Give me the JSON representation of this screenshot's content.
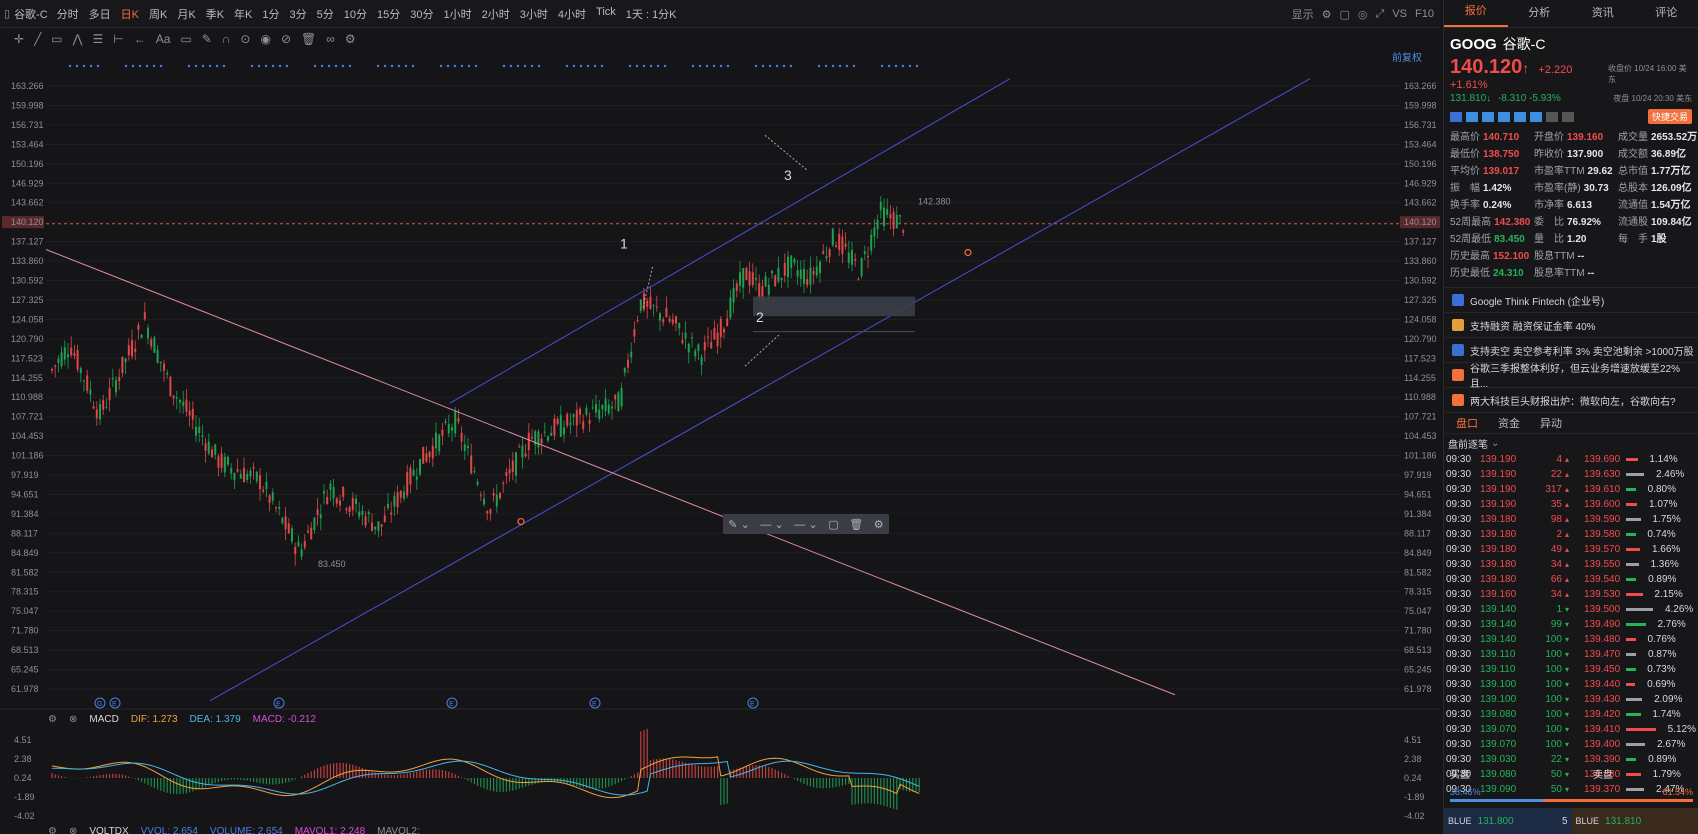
{
  "topbar": {
    "symbol": "谷歌-C",
    "timeframes": [
      "分时",
      "多日",
      "日K",
      "周K",
      "月K",
      "季K",
      "年K",
      "1分",
      "3分",
      "5分",
      "10分",
      "15分",
      "30分",
      "1小时",
      "2小时",
      "3小时",
      "4小时",
      "Tick",
      "1天 : 1分K"
    ],
    "active_timeframe": "日K",
    "right_items": [
      "显示",
      "VS",
      "F10"
    ]
  },
  "chart": {
    "price_ticks": [
      "163.266",
      "159.998",
      "156.731",
      "153.464",
      "150.196",
      "146.929",
      "143.662",
      "140.120",
      "137.127",
      "133.860",
      "130.592",
      "127.325",
      "124.058",
      "120.790",
      "117.523",
      "114.255",
      "110.988",
      "107.721",
      "104.453",
      "101.186",
      "97.919",
      "94.651",
      "91.384",
      "88.117",
      "84.849",
      "81.582",
      "78.315",
      "75.047",
      "71.780",
      "68.513",
      "65.245",
      "61.978"
    ],
    "current_price_label": "140.120",
    "high_label": "142.380",
    "low_label": "83.450",
    "wave_labels": [
      "1",
      "2",
      "3"
    ],
    "adjust_label": "前复权",
    "event_markers": [
      "E",
      "E",
      "E",
      "E",
      "E"
    ]
  },
  "macd": {
    "name": "MACD",
    "dif": "DIF: 1.273",
    "dea": "DEA: 1.379",
    "macd": "MACD: -0.212",
    "ticks": [
      "4.51",
      "2.38",
      "0.24",
      "-1.89",
      "-4.02"
    ]
  },
  "vol": {
    "name": "VOLTDX",
    "vvol": "VVOL: 2.654",
    "volume": "VOLUME: 2.654",
    "mavol1": "MAVOL1: 2.248",
    "mavol2": "MAVOL2:"
  },
  "panel": {
    "tabs": [
      "报价",
      "分析",
      "资讯",
      "评论"
    ],
    "active_tab": "报价",
    "symbol": "GOOG",
    "name": "谷歌-C",
    "price": "140.120",
    "change": "+2.220 +1.61%",
    "close_time": "收盘价 10/24 16:00 美东",
    "after_price": "131.810",
    "after_change": "-8.310 -5.93%",
    "after_time": "夜盘 10/24 20:30 美东",
    "quick_trade": "快捷交易",
    "stats": [
      [
        "最高价",
        "140.710",
        "red"
      ],
      [
        "开盘价",
        "139.160",
        "red"
      ],
      [
        "成交量",
        "2653.52万",
        "white"
      ],
      [
        "最低价",
        "138.750",
        "red"
      ],
      [
        "昨收价",
        "137.900",
        "white"
      ],
      [
        "成交额",
        "36.89亿",
        "white"
      ],
      [
        "平均价",
        "139.017",
        "red"
      ],
      [
        "市盈率TTM",
        "29.62",
        "white"
      ],
      [
        "总市值",
        "1.77万亿",
        "white"
      ],
      [
        "振　幅",
        "1.42%",
        "white"
      ],
      [
        "市盈率(静)",
        "30.73",
        "white"
      ],
      [
        "总股本",
        "126.09亿",
        "white"
      ],
      [
        "换手率",
        "0.24%",
        "white"
      ],
      [
        "市净率",
        "6.613",
        "white"
      ],
      [
        "流通值",
        "1.54万亿",
        "white"
      ],
      [
        "52周最高",
        "142.380",
        "red"
      ],
      [
        "委　比",
        "76.92%",
        "white"
      ],
      [
        "流通股",
        "109.84亿",
        "white"
      ],
      [
        "52周最低",
        "83.450",
        "green"
      ],
      [
        "量　比",
        "1.20",
        "white"
      ],
      [
        "每　手",
        "1股",
        "white"
      ],
      [
        "历史最高",
        "152.100",
        "red"
      ],
      [
        "股息TTM",
        "--",
        "white"
      ],
      [
        "",
        "",
        "white"
      ],
      [
        "历史最低",
        "24.310",
        "green"
      ],
      [
        "股息率TTM",
        "--",
        "white"
      ],
      [
        "",
        "",
        "white"
      ]
    ],
    "news": [
      "Google Think Fintech (企业号)",
      "支持融资 融资保证金率 40%",
      "支持卖空 卖空参考利率 3% 卖空池剩余 >1000万股",
      "谷歌三季报整体利好，但云业务增速放缓至22%且...",
      "两大科技巨头财报出炉：微软向左，谷歌向右?"
    ],
    "subtabs": [
      "盘口",
      "资金",
      "异动"
    ],
    "trades_title": "盘前逐笔",
    "trades": [
      [
        "09:30",
        "139.190",
        "4",
        "red",
        "139.690",
        "1.14%"
      ],
      [
        "09:30",
        "139.190",
        "22",
        "red",
        "139.630",
        "2.46%"
      ],
      [
        "09:30",
        "139.190",
        "317",
        "red",
        "139.610",
        "0.80%"
      ],
      [
        "09:30",
        "139.190",
        "35",
        "red",
        "139.600",
        "1.07%"
      ],
      [
        "09:30",
        "139.180",
        "98",
        "red",
        "139.590",
        "1.75%"
      ],
      [
        "09:30",
        "139.180",
        "2",
        "red",
        "139.580",
        "0.74%"
      ],
      [
        "09:30",
        "139.180",
        "49",
        "red",
        "139.570",
        "1.66%"
      ],
      [
        "09:30",
        "139.180",
        "34",
        "red",
        "139.550",
        "1.36%"
      ],
      [
        "09:30",
        "139.180",
        "66",
        "red",
        "139.540",
        "0.89%"
      ],
      [
        "09:30",
        "139.160",
        "34",
        "red",
        "139.530",
        "2.15%"
      ],
      [
        "09:30",
        "139.140",
        "1",
        "green",
        "139.500",
        "4.26%"
      ],
      [
        "09:30",
        "139.140",
        "99",
        "green",
        "139.490",
        "2.76%"
      ],
      [
        "09:30",
        "139.140",
        "100",
        "green",
        "139.480",
        "0.76%"
      ],
      [
        "09:30",
        "139.110",
        "100",
        "green",
        "139.470",
        "0.87%"
      ],
      [
        "09:30",
        "139.110",
        "100",
        "green",
        "139.450",
        "0.73%"
      ],
      [
        "09:30",
        "139.100",
        "100",
        "green",
        "139.440",
        "0.69%"
      ],
      [
        "09:30",
        "139.100",
        "100",
        "green",
        "139.430",
        "2.09%"
      ],
      [
        "09:30",
        "139.080",
        "100",
        "green",
        "139.420",
        "1.74%"
      ],
      [
        "09:30",
        "139.070",
        "100",
        "green",
        "139.410",
        "5.12%"
      ],
      [
        "09:30",
        "139.070",
        "100",
        "green",
        "139.400",
        "2.67%"
      ],
      [
        "09:30",
        "139.030",
        "22",
        "green",
        "139.390",
        "0.89%"
      ],
      [
        "09:30",
        "139.080",
        "50",
        "green",
        "139.380",
        "1.79%"
      ],
      [
        "09:30",
        "139.090",
        "50",
        "green",
        "139.370",
        "2.47%"
      ]
    ],
    "ob": {
      "buy": "买盘",
      "sell": "卖盘",
      "buy_ratio": "38.46%",
      "sell_ratio": "61.54%",
      "buy_fraction": 0.3846,
      "bid_venue": "BLUE",
      "bid_price": "131.800",
      "bid_size": "5",
      "ask_venue": "BLUE",
      "ask_price": "131.810"
    }
  },
  "colors": {
    "up": "#f04c4c",
    "down": "#25b35a",
    "accent": "#f2703b"
  }
}
